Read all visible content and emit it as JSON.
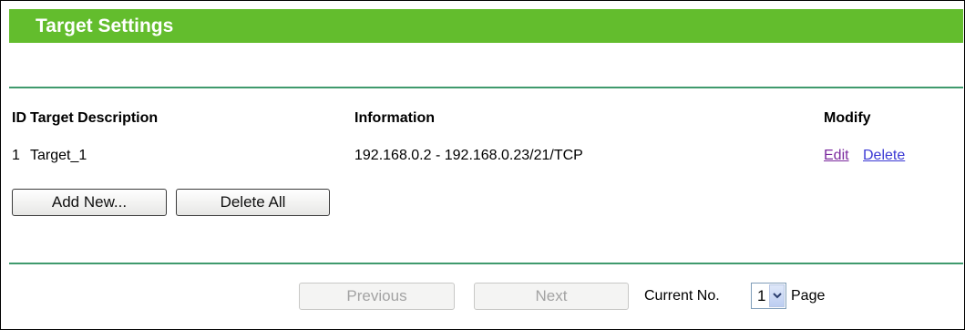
{
  "header": {
    "title": "Target Settings"
  },
  "table": {
    "columns": {
      "id": "ID",
      "description": "Target Description",
      "information": "Information",
      "modify": "Modify"
    },
    "rows": [
      {
        "id": "1",
        "description": "Target_1",
        "information": "192.168.0.2 - 192.168.0.23/21/TCP",
        "edit": "Edit",
        "delete": "Delete"
      }
    ]
  },
  "actions": {
    "add_new": "Add New...",
    "delete_all": "Delete All"
  },
  "pagination": {
    "previous": "Previous",
    "next": "Next",
    "current_label": "Current No.",
    "current_value": "1",
    "page_label": "Page"
  },
  "colors": {
    "header_bg": "#63bd2d",
    "rule": "#3f9a6d",
    "link": "#3b39d4",
    "visited_link": "#7b2a9e"
  }
}
